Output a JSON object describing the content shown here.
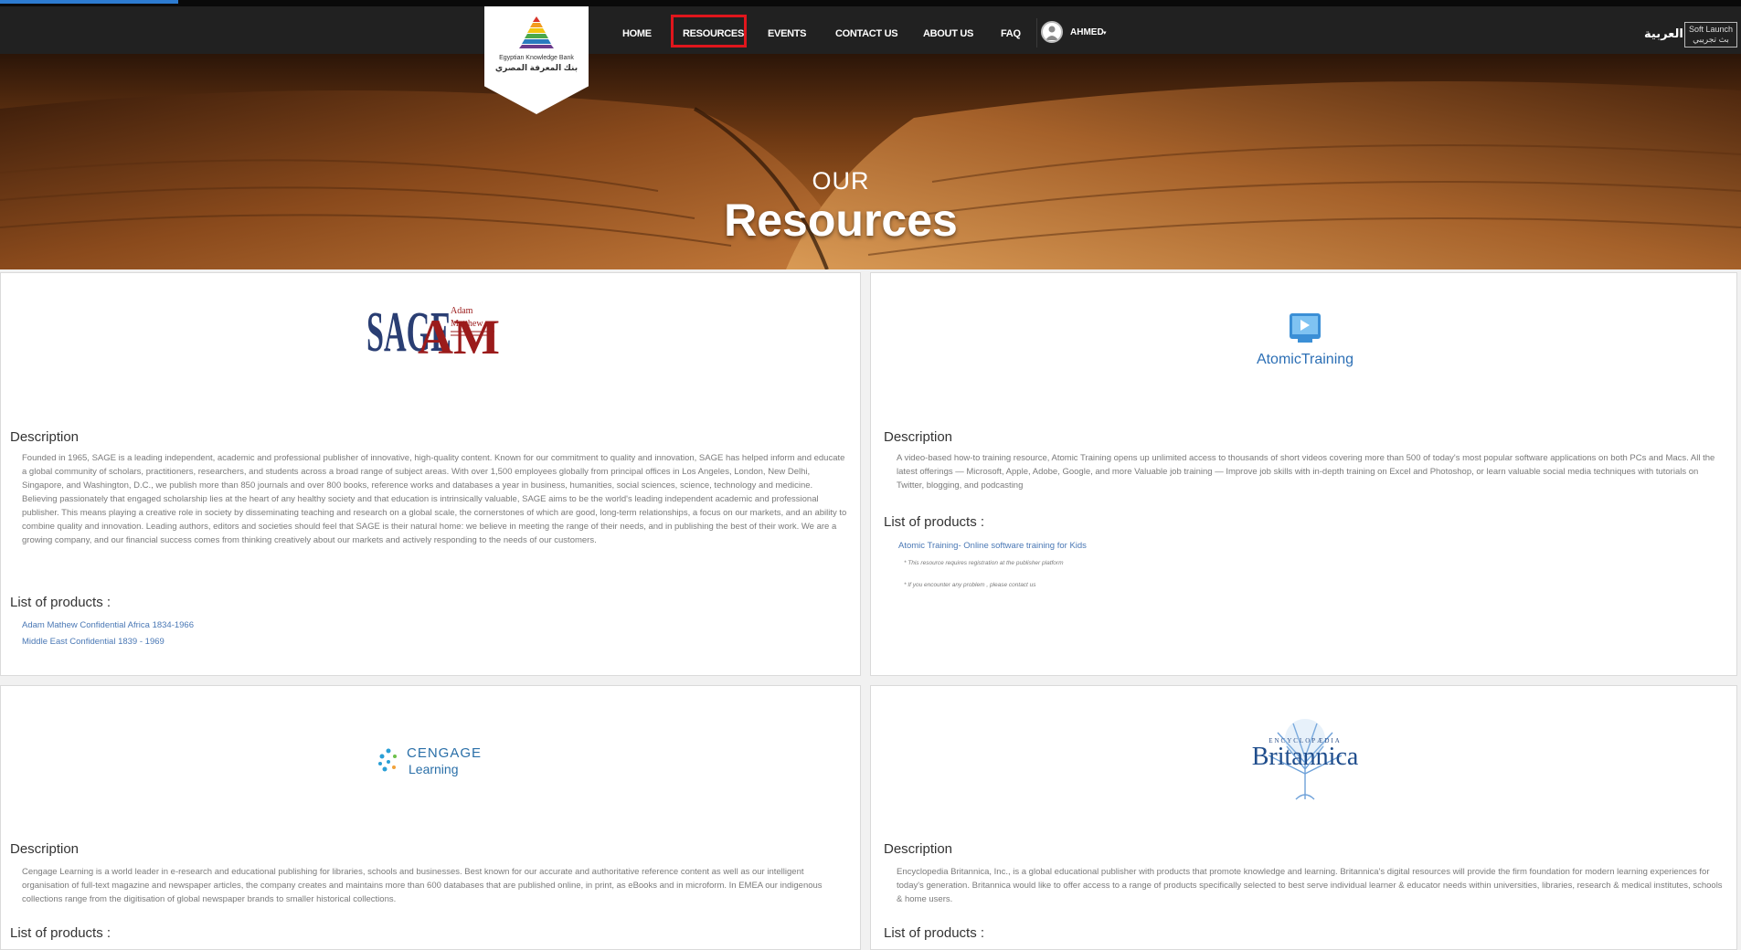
{
  "nav": {
    "logo_text_en": "Egyptian Knowledge Bank",
    "logo_text_ar": "بنك المعرفة المصري",
    "links": [
      "HOME",
      "RESOURCES",
      "EVENTS",
      "CONTACT US",
      "ABOUT US",
      "FAQ"
    ],
    "active": "RESOURCES",
    "user_name": "AHMED",
    "user_caret": "▾",
    "arabic_link": "العربية",
    "soft_launch_en": "Soft Launch",
    "soft_launch_ar": "بث تجريبي"
  },
  "hero": {
    "our": "OUR",
    "title": "Resources"
  },
  "cards": [
    {
      "logo": "SAGE | Adam Matthew",
      "logo_sub": "Primary sources for teaching and research",
      "description_heading": "Description",
      "description": "Founded in 1965, SAGE is a leading independent, academic and professional publisher of innovative, high-quality content. Known for our commitment to quality and innovation, SAGE has helped inform and educate a global community of scholars, practitioners, researchers, and students across a broad range of subject areas. With over 1,500 employees globally from principal offices in Los Angeles, London, New Delhi, Singapore, and Washington, D.C., we publish more than 850 journals and over 800 books, reference works and databases a year in business, humanities, social sciences, science, technology and medicine. Believing passionately that engaged scholarship lies at the heart of any healthy society and that education is intrinsically valuable, SAGE aims to be the world's leading independent academic and professional publisher. This means playing a creative role in society by disseminating teaching and research on a global scale, the cornerstones of which are good, long-term relationships, a focus on our markets, and an ability to combine quality and innovation. Leading authors, editors and societies should feel that SAGE is their natural home: we believe in meeting the range of their needs, and in publishing the best of their work. We are a growing company, and our financial success comes from thinking creatively about our markets and actively responding to the needs of our customers.",
      "products_heading": "List of products :",
      "products": [
        "Adam Mathew Confidential Africa 1834-1966",
        "Middle East Confidential 1839 - 1969"
      ]
    },
    {
      "logo": "AtomicTraining",
      "description_heading": "Description",
      "description": "A video-based how-to training resource, Atomic Training opens up unlimited access to thousands of short videos covering more than 500 of today's most popular software applications on both PCs and Macs. All the latest offerings — Microsoft, Apple, Adobe, Google, and more Valuable job training — Improve job skills with in-depth training on Excel and Photoshop, or learn valuable social media techniques with tutorials on Twitter, blogging, and podcasting",
      "products_heading": "List of products :",
      "products": [
        "Atomic Training- Online software training for Kids"
      ],
      "notes": [
        "* This resource requires registration at the publisher platform",
        "* If you encounter any problem , please contact us"
      ]
    },
    {
      "logo_line1": "CENGAGE",
      "logo_line2": "Learning",
      "description_heading": "Description",
      "description": "Cengage Learning is a world leader in e-research and educational publishing for libraries, schools and businesses. Best known for our accurate and authoritative reference content as well as our intelligent organisation of full-text magazine and newspaper articles, the company creates and maintains more than 600 databases that are published online, in print, as eBooks and in microform. In EMEA our indigenous collections range from the digitisation of global newspaper brands to smaller historical collections.",
      "products_heading": "List of products :"
    },
    {
      "logo_top": "ENCYCLOPÆDIA",
      "logo": "Britannica",
      "description_heading": "Description",
      "description": "Encyclopedia Britannica, Inc., is a global educational publisher with products that promote knowledge and learning. Britannica's digital resources will provide the firm foundation for modern learning experiences for today's generation. Britannica would like to offer access to a range of products specifically selected to best serve individual learner & educator needs within universities, libraries, research & medical institutes, schools & home users.",
      "products_heading": "List of products :"
    }
  ]
}
